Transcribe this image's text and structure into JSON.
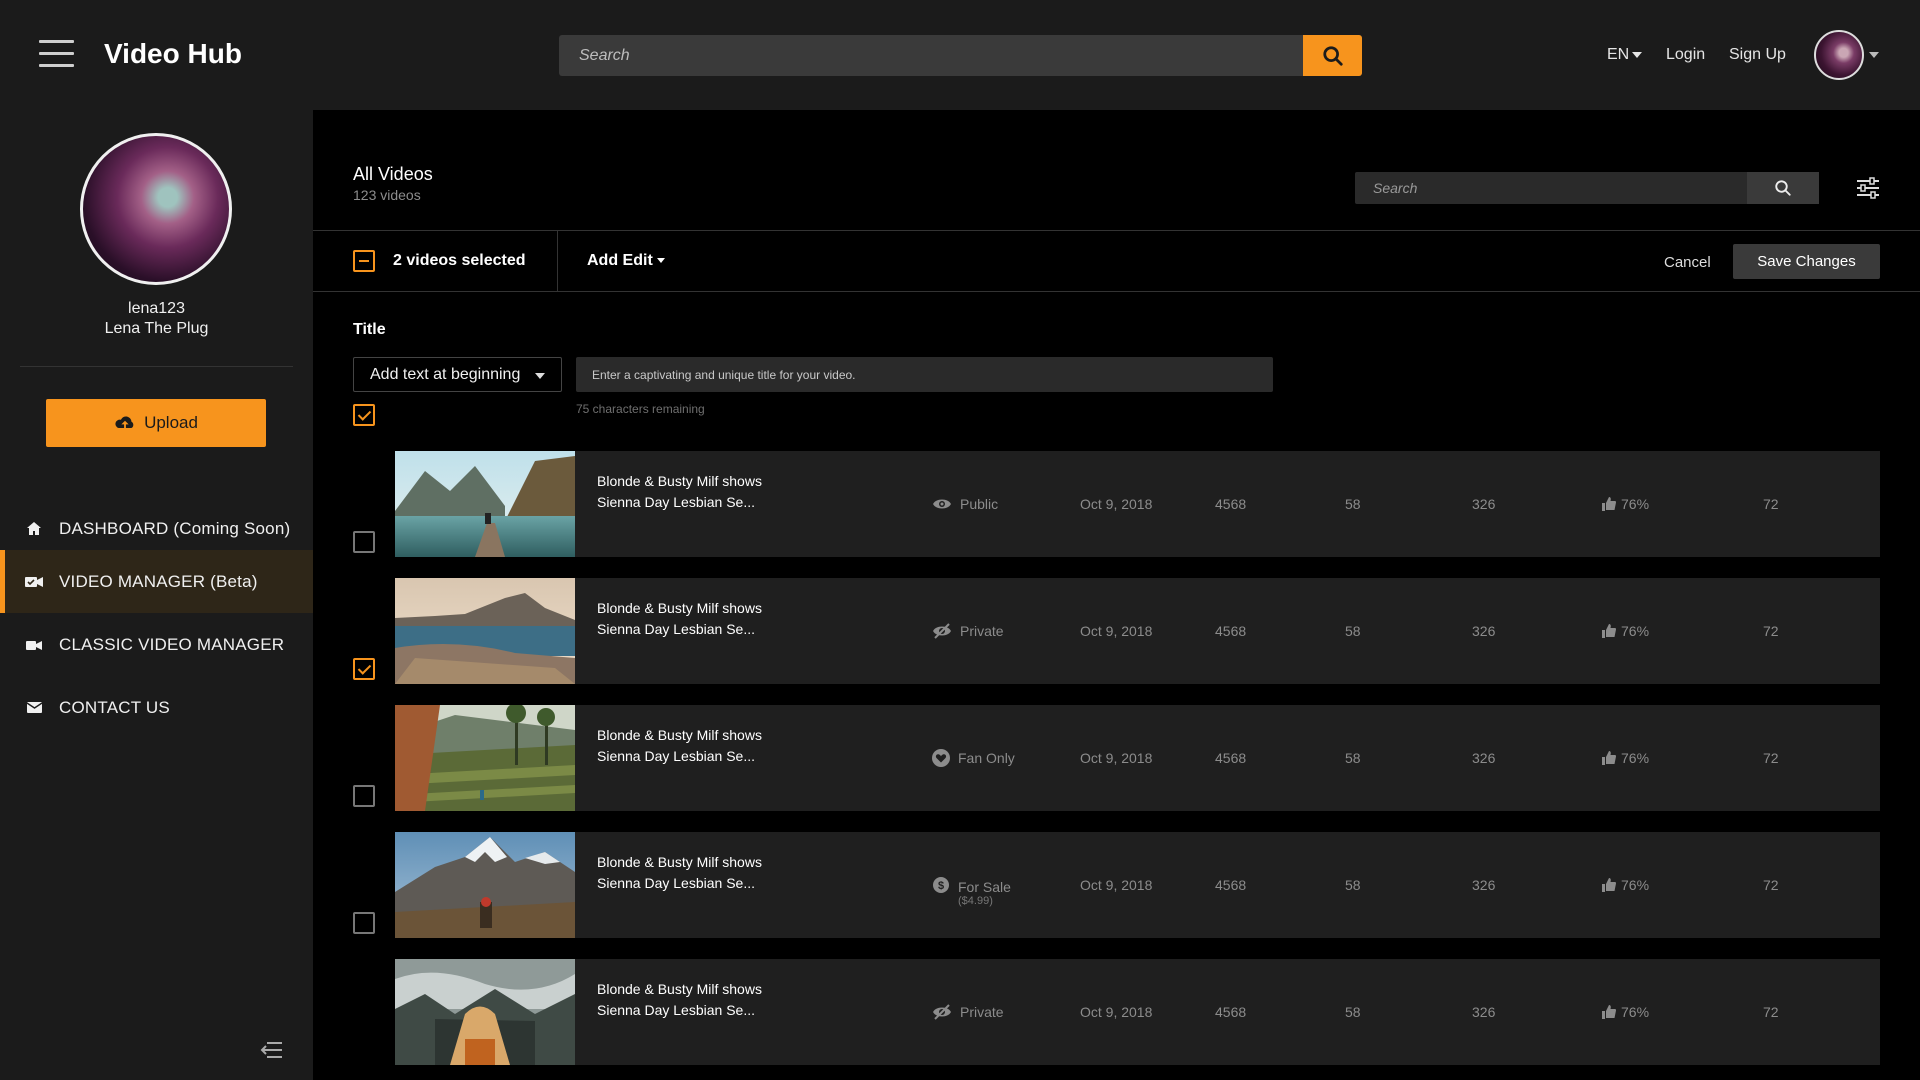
{
  "app": {
    "title": "Video Hub"
  },
  "header": {
    "search_placeholder": "Search",
    "language": "EN",
    "login": "Login",
    "signup": "Sign Up"
  },
  "sidebar": {
    "username": "lena123",
    "display_name": "Lena The Plug",
    "upload_label": "Upload",
    "items": [
      {
        "label": "DASHBOARD (Coming Soon)",
        "icon": "home-icon"
      },
      {
        "label": "VIDEO MANAGER (Beta)",
        "icon": "video-manager-icon",
        "active": true
      },
      {
        "label": "CLASSIC VIDEO MANAGER",
        "icon": "camera-icon"
      },
      {
        "label": "CONTACT US",
        "icon": "envelope-icon"
      }
    ]
  },
  "main": {
    "heading": "All Videos",
    "count": "123 videos",
    "search_placeholder": "Search",
    "selection_text": "2 videos selected",
    "add_edit": "Add Edit",
    "cancel": "Cancel",
    "save": "Save Changes",
    "title_section": {
      "label": "Title",
      "mode": "Add text at beginning",
      "placeholder": "Enter a captivating and unique title for your video.",
      "remaining": "75 characters remaining"
    }
  },
  "accent_color": "#f7941d",
  "videos": [
    {
      "checked": true,
      "title_line1": "Blonde & Busty Milf shows",
      "title_line2": "Sienna Day Lesbian Se...",
      "status": "Public",
      "status_icon": "eye-icon",
      "date": "Oct 9, 2018",
      "views": "4568",
      "col_a": "58",
      "col_b": "326",
      "rating": "76%",
      "col_c": "72"
    },
    {
      "checked": false,
      "title_line1": "Blonde & Busty Milf shows",
      "title_line2": "Sienna Day Lesbian Se...",
      "status": "Private",
      "status_icon": "eye-slash-icon",
      "date": "Oct 9, 2018",
      "views": "4568",
      "col_a": "58",
      "col_b": "326",
      "rating": "76%",
      "col_c": "72"
    },
    {
      "checked": true,
      "title_line1": "Blonde & Busty Milf shows",
      "title_line2": "Sienna Day Lesbian Se...",
      "status": "Fan Only",
      "status_icon": "heart-icon",
      "date": "Oct 9, 2018",
      "views": "4568",
      "col_a": "58",
      "col_b": "326",
      "rating": "76%",
      "col_c": "72"
    },
    {
      "checked": false,
      "title_line1": "Blonde & Busty Milf shows",
      "title_line2": "Sienna Day Lesbian Se...",
      "status": "For Sale",
      "status_sub": "($4.99)",
      "status_icon": "dollar-icon",
      "date": "Oct 9, 2018",
      "views": "4568",
      "col_a": "58",
      "col_b": "326",
      "rating": "76%",
      "col_c": "72"
    },
    {
      "checked": false,
      "title_line1": "Blonde & Busty Milf shows",
      "title_line2": "Sienna Day Lesbian Se...",
      "status": "Private",
      "status_icon": "eye-slash-icon",
      "date": "Oct 9, 2018",
      "views": "4568",
      "col_a": "58",
      "col_b": "326",
      "rating": "76%",
      "col_c": "72"
    }
  ]
}
